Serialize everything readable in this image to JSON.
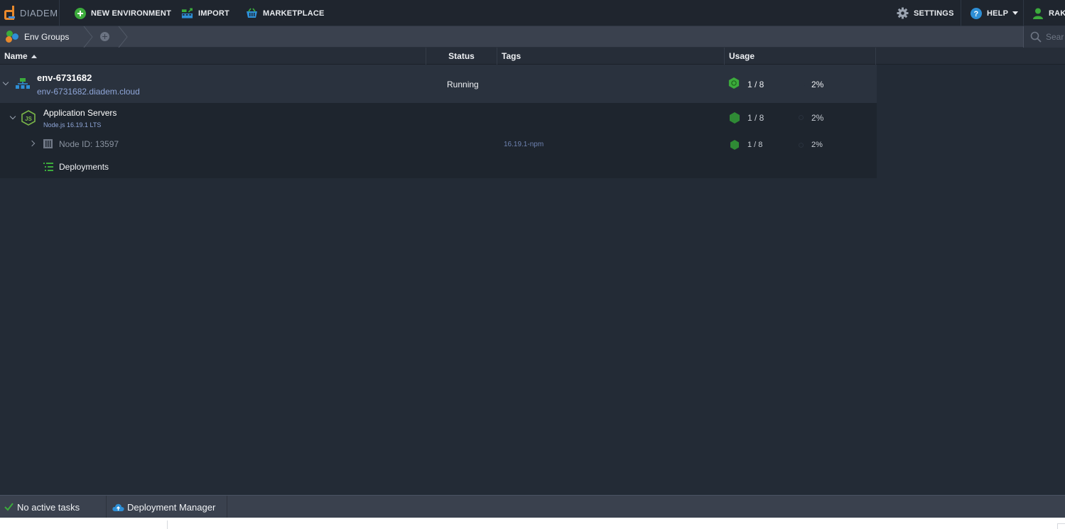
{
  "topbar": {
    "logo_text": "DIADEM",
    "new_environment": "NEW ENVIRONMENT",
    "import": "IMPORT",
    "marketplace": "MARKETPLACE",
    "settings": "SETTINGS",
    "help": "HELP",
    "user": "RAK"
  },
  "breadcrumb": {
    "env_groups": "Env Groups",
    "search_placeholder": "Sear"
  },
  "columns": {
    "name": "Name",
    "status": "Status",
    "tags": "Tags",
    "usage": "Usage"
  },
  "environment": {
    "name": "env-6731682",
    "domain": "env-6731682.diadem.cloud",
    "status": "Running",
    "cloudlets": "1 / 8",
    "disk": "2%"
  },
  "app_servers": {
    "title": "Application Servers",
    "subtitle": "Node.js 16.19.1 LTS",
    "cloudlets": "1 / 8",
    "disk": "2%"
  },
  "node": {
    "label": "Node ID: 13597",
    "tag": "16.19.1-npm",
    "cloudlets": "1 / 8",
    "disk": "2%"
  },
  "deployments": {
    "label": "Deployments"
  },
  "bottombar": {
    "tasks": "No active tasks",
    "deployment_manager": "Deployment Manager"
  },
  "colors": {
    "accent_green": "#3cab3c",
    "link_blue": "#8fa6d8",
    "background": "#232b36"
  }
}
